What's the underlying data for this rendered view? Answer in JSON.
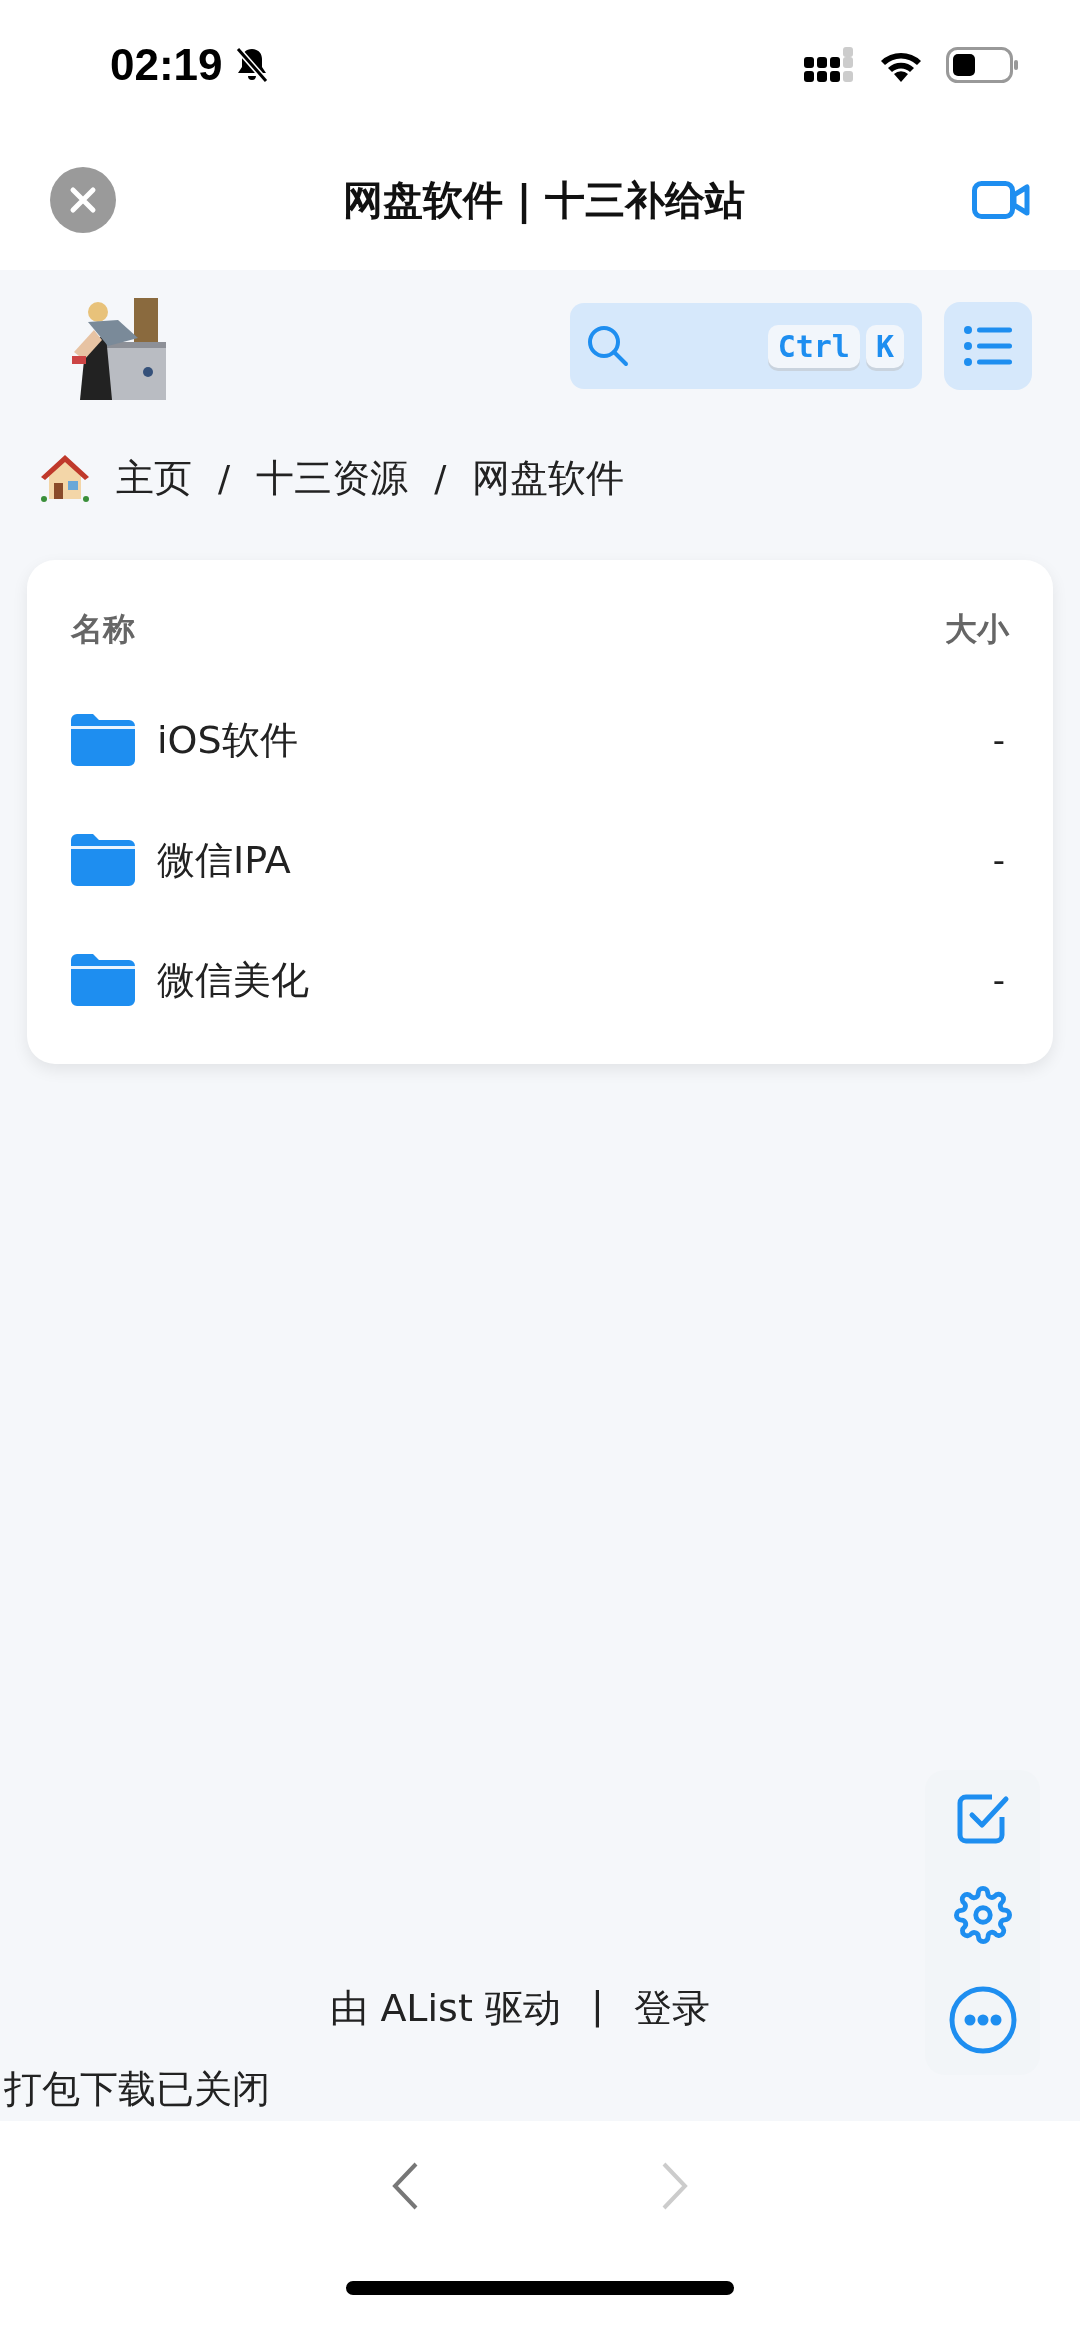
{
  "status_bar": {
    "time": "02:19"
  },
  "browser_header": {
    "title": "网盘软件 | 十三补给站"
  },
  "search": {
    "keys": [
      "Ctrl",
      "K"
    ]
  },
  "breadcrumb": [
    "主页",
    "十三资源",
    "网盘软件"
  ],
  "breadcrumb_separator": "/",
  "table": {
    "columns": [
      "名称",
      "大小"
    ],
    "rows": [
      {
        "name": "iOS软件",
        "size": "-"
      },
      {
        "name": "微信IPA",
        "size": "-"
      },
      {
        "name": "微信美化",
        "size": "-"
      }
    ]
  },
  "footer": {
    "powered_by": "由 AList 驱动",
    "separator": "|",
    "login": "登录"
  },
  "toast": "打包下载已关闭"
}
